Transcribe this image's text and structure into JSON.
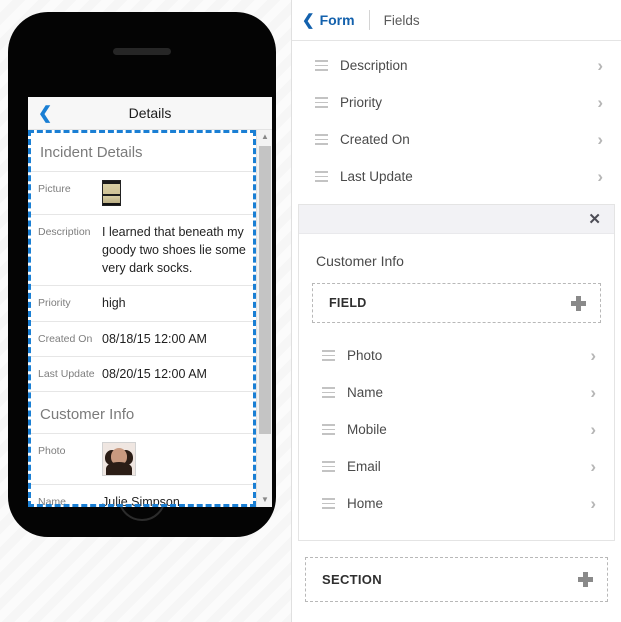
{
  "editor": {
    "header": {
      "back_icon": "chevron-left-icon",
      "breadcrumb": "Form",
      "tab": "Fields"
    },
    "top_fields": [
      {
        "label": "Description"
      },
      {
        "label": "Priority"
      },
      {
        "label": "Created On"
      },
      {
        "label": "Last Update"
      }
    ],
    "section_card": {
      "close_icon": "✕",
      "title": "Customer Info",
      "add_field_button": {
        "label": "FIELD",
        "icon": "plus-icon"
      },
      "fields": [
        {
          "label": "Photo"
        },
        {
          "label": "Name"
        },
        {
          "label": "Mobile"
        },
        {
          "label": "Email"
        },
        {
          "label": "Home"
        }
      ]
    },
    "add_section_button": {
      "label": "SECTION",
      "icon": "plus-icon"
    },
    "chevron": "›",
    "colors": {
      "accent_blue": "#1361ad",
      "selection_blue": "#1a7fd4",
      "chevron_gray": "#b6b6b6",
      "card_header_gray": "#f2f2f5"
    }
  },
  "phone": {
    "navbar": {
      "back_icon": "chevron-left-icon",
      "title": "Details"
    },
    "sections": [
      {
        "title": "Incident Details",
        "rows": [
          {
            "label": "Picture",
            "value": "",
            "kind": "image"
          },
          {
            "label": "Description",
            "value": "I learned that beneath my goody two shoes lie some very dark socks.",
            "kind": "text"
          },
          {
            "label": "Priority",
            "value": "high",
            "kind": "text"
          },
          {
            "label": "Created On",
            "value": "08/18/15 12:00 AM",
            "kind": "text"
          },
          {
            "label": "Last Update",
            "value": "08/20/15 12:00 AM",
            "kind": "text"
          }
        ]
      },
      {
        "title": "Customer Info",
        "rows": [
          {
            "label": "Photo",
            "value": "",
            "kind": "image"
          },
          {
            "label": "Name",
            "value": "Julie Simpson",
            "kind": "text"
          }
        ]
      }
    ],
    "scrollbar": {
      "up": "▲",
      "down": "▼"
    }
  }
}
